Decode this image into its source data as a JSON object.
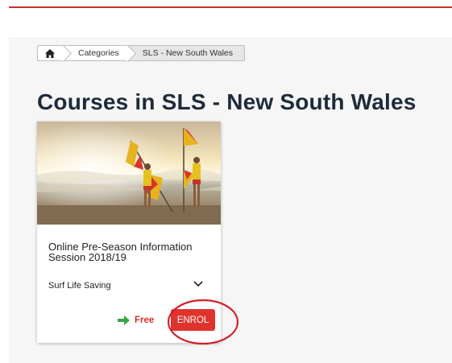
{
  "breadcrumb": {
    "home_icon": "home-icon",
    "items": [
      "Categories",
      "SLS - New South Wales"
    ]
  },
  "page_title": "Courses in SLS - New South Wales",
  "course_card": {
    "image_alt": "surf-lifesavers-with-flags-photo",
    "title": "Online Pre-Season Information Session 2018/19",
    "category": "Surf Life Saving",
    "expand_icon": "chevron-down-icon",
    "price_icon": "arrow-right-icon",
    "price": "Free",
    "enrol_label": "ENROL"
  },
  "colors": {
    "accent": "#e0332d",
    "title": "#1e2b3c",
    "price_arrow": "#3aa545",
    "annotation": "#d0202a"
  }
}
